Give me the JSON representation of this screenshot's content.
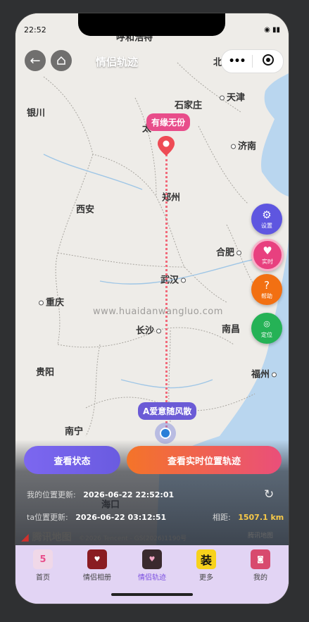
{
  "status_bar": {
    "time": "22:52"
  },
  "nav": {
    "back_icon": "back-arrow-icon",
    "home_icon": "home-icon",
    "title": "情侣轨迹"
  },
  "map": {
    "cities": {
      "huhehaote": "呼和浩特",
      "beijing": "北",
      "yinchuan": "银川",
      "shijiazhuang": "石家庄",
      "tianjin": "天津",
      "taiyuan": "太",
      "jinan": "济南",
      "xian": "西安",
      "zhengzhou": "郑州",
      "nanjing": "南京",
      "hefei": "合肥",
      "wuhan": "武汉",
      "chongqing": "重庆",
      "changsha": "长沙",
      "nanchang": "南昌",
      "guiyang": "贵阳",
      "fuzhou": "福州",
      "nanning": "南宁",
      "haikou": "海口"
    },
    "marker_top_label": "有缘无份",
    "marker_bottom_label": "A爱意随风散",
    "watermark": "www.huaidanwangluo.com"
  },
  "fabs": {
    "settings": "设置",
    "realtime": "实时",
    "help_symbol": "?",
    "help": "帮助",
    "locate_symbol": "◎",
    "locate": "定位"
  },
  "buttons": {
    "status": "查看状态",
    "track": "查看实时位置轨迹"
  },
  "info": {
    "my_label": "我的位置更新:",
    "my_time": "2026-06-22 22:52:01",
    "ta_label": "ta位置更新:",
    "ta_time": "2026-06-22 03:12:51",
    "distance_label": "相距:",
    "distance_value": "1507.1 km"
  },
  "map_footer": {
    "logo": "腾讯地图",
    "copyright": "©2026 Tencent - GS(2026)1190号",
    "brand_small": "腾讯地图"
  },
  "tabbar": [
    {
      "label": "首页",
      "icon": "home-tab-icon"
    },
    {
      "label": "情侣相册",
      "icon": "album-tab-icon"
    },
    {
      "label": "情侣轨迹",
      "icon": "track-tab-icon",
      "active": true
    },
    {
      "label": "更多",
      "icon": "more-tab-icon",
      "badge_text": "装"
    },
    {
      "label": "我的",
      "icon": "profile-tab-icon"
    }
  ],
  "colors": {
    "accent_purple": "#6b5bd6",
    "accent_pink": "#e84d8a",
    "accent_orange": "#f27012",
    "accent_green": "#25b256",
    "distance_yellow": "#f7c948"
  }
}
